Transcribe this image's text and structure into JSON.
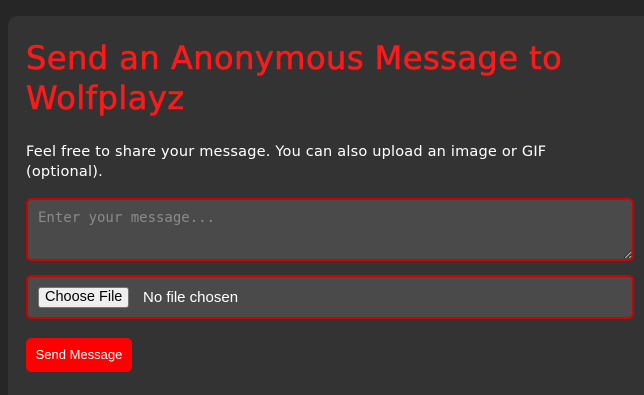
{
  "page": {
    "title": "Send an Anonymous Message to Wolfplayz",
    "description": "Feel free to share your message. You can also upload an image or GIF (optional)."
  },
  "form": {
    "message_placeholder": "Enter your message...",
    "message_value": "",
    "file_button_label": "Choose File",
    "file_status": "No file chosen",
    "submit_label": "Send Message"
  },
  "colors": {
    "accent": "#ff0000",
    "background": "#262626",
    "card": "#333333",
    "field": "#4a4a4a",
    "text": "#ffffff"
  }
}
